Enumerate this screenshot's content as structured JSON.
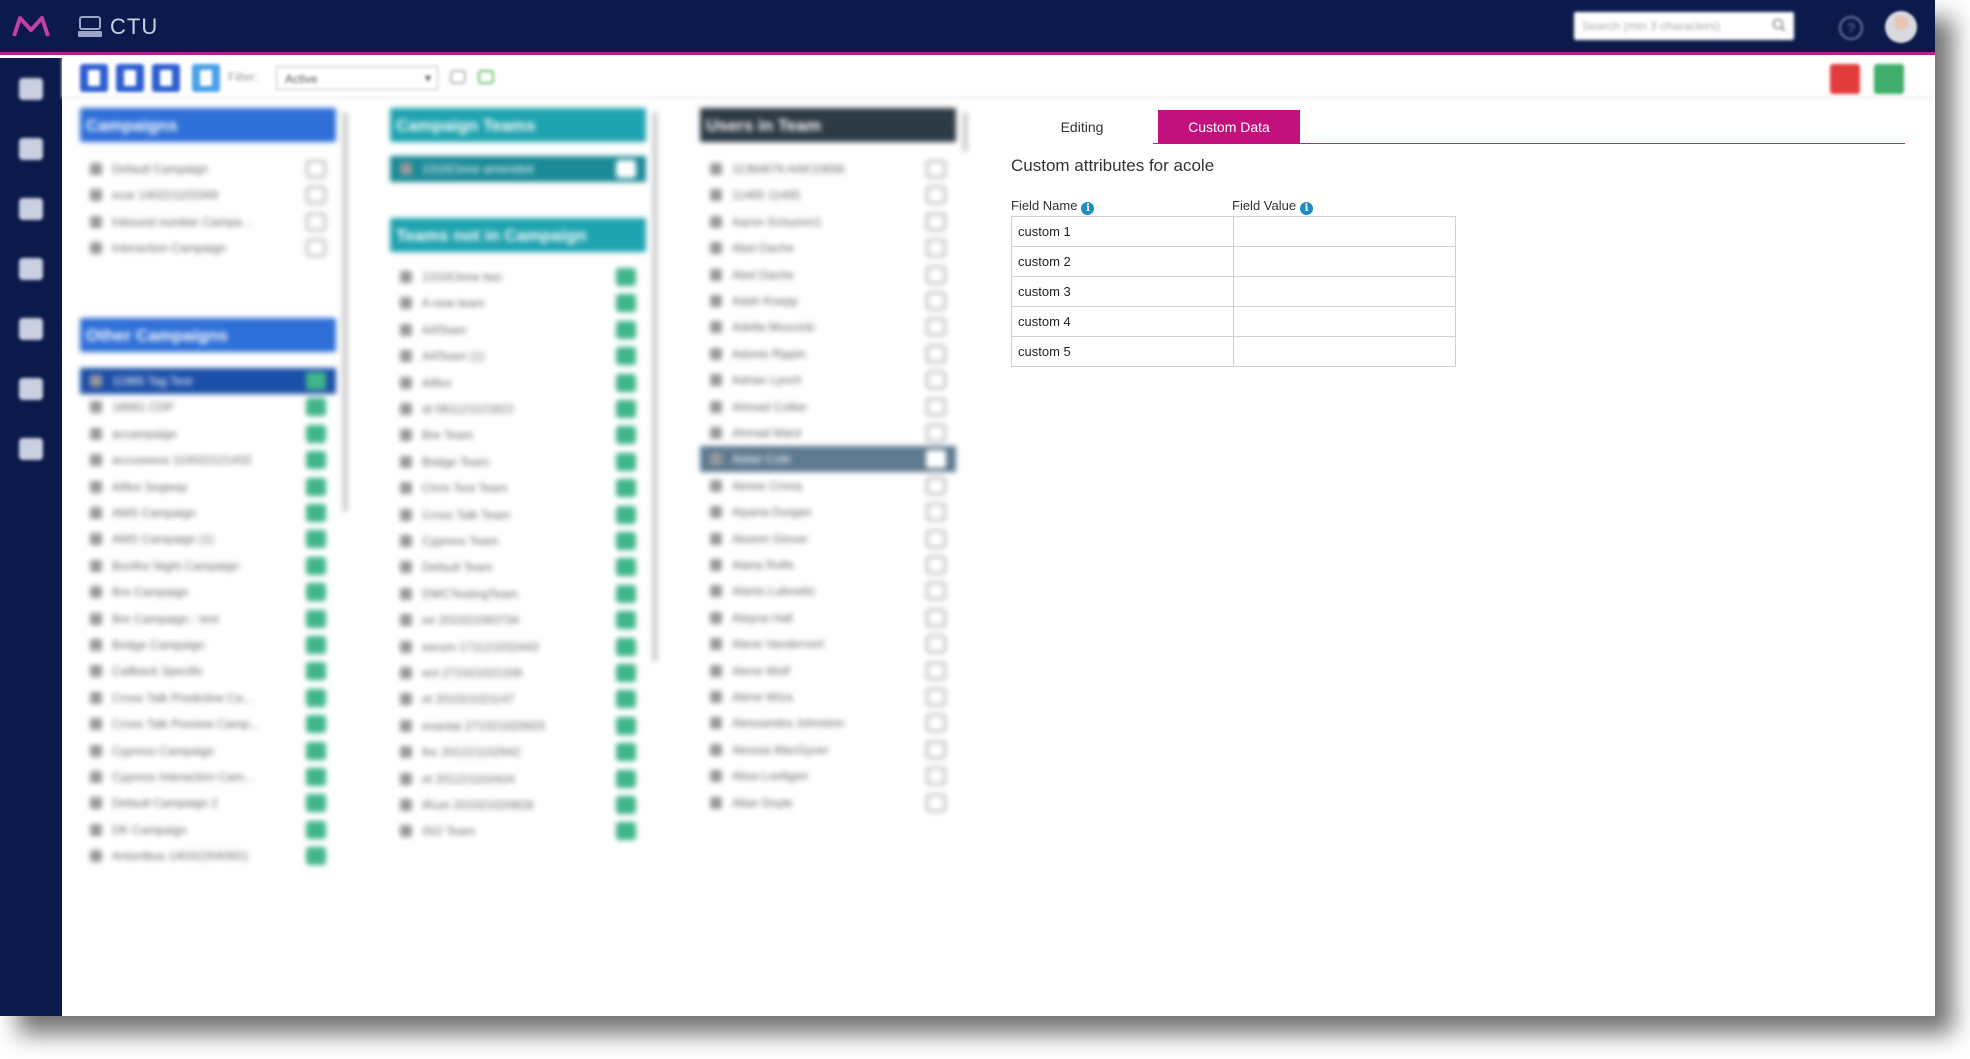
{
  "header": {
    "app_name": "CTU",
    "search_placeholder": "Search (min 3 characters)"
  },
  "toolbar": {
    "filter_label": "Filter:",
    "filter_value": "Active"
  },
  "campaigns": {
    "title": "Campaigns",
    "items": [
      "Default Campaign",
      "ecar 140221103349",
      "Inbound number Campa...",
      "Interaction Campaign"
    ],
    "other_title": "Other Campaigns",
    "other_items": [
      "11965 Tag Test",
      "18681 CDP",
      "accampaign",
      "accuseeus 110022121432",
      "Aiflex Segway",
      "AMS Campaign",
      "AMS Campaign (1)",
      "Bonfire Night Campaign",
      "Bre Campaign",
      "Bre Campaign - test",
      "Bridge Campaign",
      "Callback Specific",
      "Cross Talk Predictive Ca...",
      "Cross Talk Preview Camp...",
      "Cypress Campaign",
      "Cypress Interaction Cam...",
      "Default Campaign 2",
      "DK Campaign",
      "Antonlbus 140322040921"
    ]
  },
  "teams": {
    "title": "Campaign Teams",
    "items": [
      "1310Clone amended"
    ],
    "not_title": "Teams not in Campaign",
    "not_items": [
      "1310Clone two",
      "A new team",
      "AATeam",
      "AATeam (1)",
      "Aiflex",
      "at 081121121822",
      "Bre Team",
      "Bridge Team",
      "Chris Test Team",
      "Cross Talk Team",
      "Cypress Team",
      "Default Team",
      "DWCTestingTeam",
      "ee 201021093734",
      "eerum 171121032443",
      "ent 271021021339",
      "et 201021021147",
      "evantat 271021020933",
      "fec 201221102942",
      "et 201221102424",
      "iRum 201021020828",
      "ISO Team"
    ]
  },
  "users": {
    "title": "Users in Team",
    "items": [
      "11364676 AAK10656",
      "11465 11465",
      "Aaron Schumm1",
      "Abel Dache",
      "Abel Dache",
      "Adah Koepp",
      "Adella Moscicki",
      "Adonis Rippin",
      "Adrian Lynch",
      "Ahmad Collier",
      "Ahmad Mard",
      "Aidan Cole",
      "Aimee Crona",
      "Aiyana Durgan",
      "Akeem Glover",
      "Alana Rolfe",
      "Alanis Lubowitz",
      "Alayna Hall",
      "Alene Vandervort",
      "Alene Wolf",
      "Alene Wiza",
      "Alessandra Johnston",
      "Alessia MacGyver",
      "Alisa Luettgen",
      "Allan Doyle"
    ]
  },
  "detail": {
    "tabs": [
      "Editing",
      "Custom Data"
    ],
    "title": "Custom attributes for acole",
    "field_name_header": "Field Name",
    "field_value_header": "Field Value",
    "info_glyph": "i",
    "rows": [
      {
        "name": "custom 1",
        "value": ""
      },
      {
        "name": "custom 2",
        "value": ""
      },
      {
        "name": "custom 3",
        "value": ""
      },
      {
        "name": "custom 4",
        "value": ""
      },
      {
        "name": "custom 5",
        "value": ""
      }
    ]
  },
  "colors": {
    "topbar": "#0c1a4b",
    "accent": "#c2117c",
    "campaign_header": "#2e6fd8",
    "team_header": "#1fa3b0",
    "user_header": "#2d3a44",
    "info": "#1c8bc9"
  },
  "icons": [
    "brand-logo-icon",
    "ctu-icon",
    "search-icon",
    "help-icon",
    "info-icon"
  ]
}
